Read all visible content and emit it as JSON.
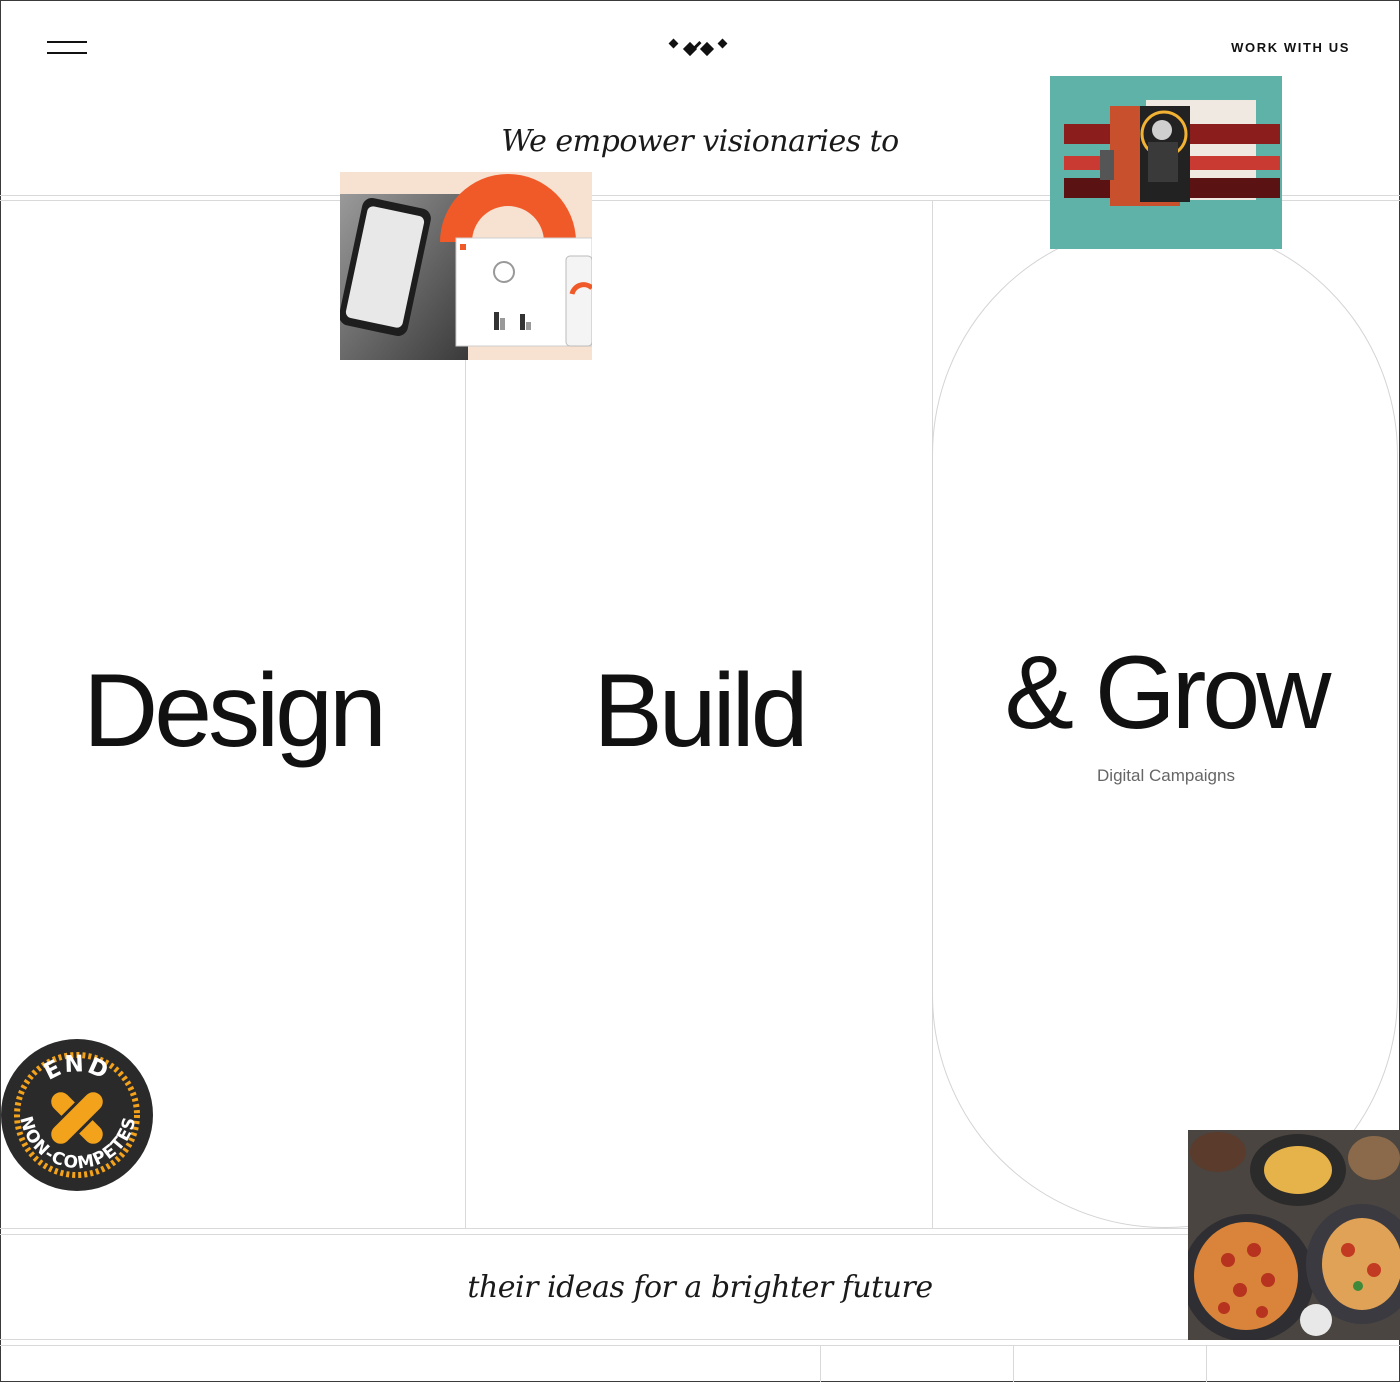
{
  "header": {
    "menu_icon": "hamburger-menu-icon",
    "logo_icon": "diamond-cluster-logo-icon",
    "cta_label": "WORK WITH US"
  },
  "hero": {
    "tagline_top": "We empower visionaries to",
    "columns": [
      {
        "word": "Design",
        "subtitle": ""
      },
      {
        "word": "Build",
        "subtitle": ""
      },
      {
        "word": "& Grow",
        "subtitle": "Digital Campaigns"
      }
    ],
    "tagline_bottom": "their ideas for a brighter future"
  },
  "badge": {
    "icon": "end-non-competes-badge-icon",
    "line1": "END",
    "line2": "NON-COMPETES"
  },
  "images": {
    "app_preview": "dashboard-app-preview-image",
    "collage": "portrait-collage-image",
    "food": "pizza-table-image"
  },
  "colors": {
    "accent_orange": "#f05a28",
    "collage_teal": "#5fb2a8",
    "badge_dark": "#2a2a2a",
    "badge_yellow": "#f3a21b",
    "thumb_peach": "#f7e1d1"
  }
}
